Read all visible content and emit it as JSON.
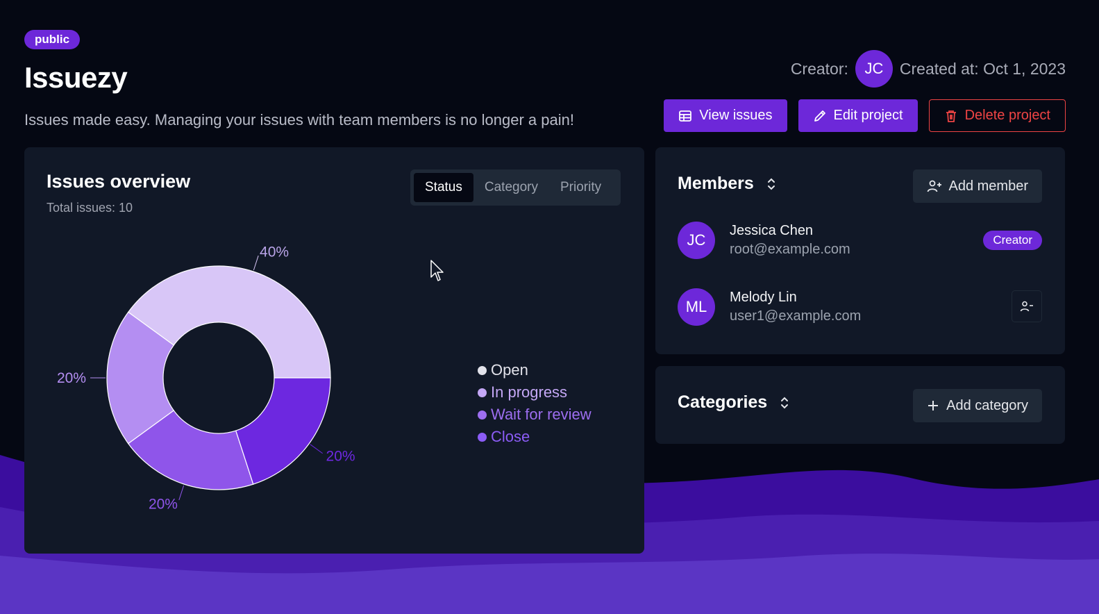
{
  "project": {
    "visibility": "public",
    "title": "Issuezy",
    "description": "Issues made easy. Managing your issues with team members is no longer a pain!",
    "creator_label": "Creator:",
    "creator_initials": "JC",
    "created_at": "Created at: Oct 1, 2023"
  },
  "actions": {
    "view_issues": "View issues",
    "edit_project": "Edit project",
    "delete_project": "Delete project"
  },
  "overview": {
    "title": "Issues overview",
    "total": "Total issues: 10",
    "tabs": [
      "Status",
      "Category",
      "Priority"
    ],
    "active_tab": "Status"
  },
  "chart_data": {
    "type": "pie",
    "donut": true,
    "categories": [
      "Open",
      "In progress",
      "Wait for review",
      "Close"
    ],
    "values": [
      40,
      20,
      20,
      20
    ],
    "labels": [
      "40%",
      "20%",
      "20%",
      "20%"
    ],
    "colors": [
      "#d8c6f7",
      "#b48ef2",
      "#8f55ea",
      "#6d28e0"
    ],
    "legend_colors": [
      "#e2e2ea",
      "#c4a7f5",
      "#9d6ef0",
      "#8b5cf6"
    ],
    "legend_placement": "right"
  },
  "members": {
    "title": "Members",
    "add_label": "Add member",
    "list": [
      {
        "initials": "JC",
        "name": "Jessica Chen",
        "email": "root@example.com",
        "role": "Creator"
      },
      {
        "initials": "ML",
        "name": "Melody Lin",
        "email": "user1@example.com"
      }
    ]
  },
  "categories": {
    "title": "Categories",
    "add_label": "Add category"
  },
  "colors": {
    "accent": "#6d28d9",
    "danger": "#ef4444",
    "background": "#050813",
    "card": "#111827"
  },
  "icons": {
    "view_issues": "table-icon",
    "edit_project": "pencil-icon",
    "delete_project": "trash-icon",
    "sort": "chevron-up-down-icon",
    "add_member": "user-plus-icon",
    "remove_member": "user-minus-icon",
    "add_category": "plus-icon"
  }
}
